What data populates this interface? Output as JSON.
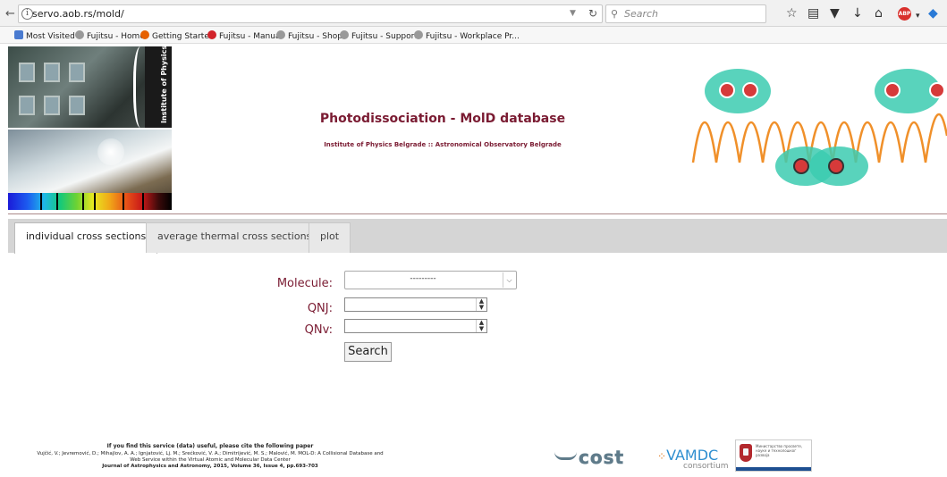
{
  "browser": {
    "url": "servo.aob.rs/mold/",
    "search_placeholder": "Search"
  },
  "bookmarks": [
    {
      "label": "Most Visited",
      "icon": "most-visited-icon",
      "color": "#4a7bd0"
    },
    {
      "label": "Fujitsu - Home",
      "icon": "globe-icon",
      "color": "#888888"
    },
    {
      "label": "Getting Started",
      "icon": "firefox-icon",
      "color": "#e66000"
    },
    {
      "label": "Fujitsu - Manual",
      "icon": "infinity-icon",
      "color": "#d2232a"
    },
    {
      "label": "Fujitsu - Shop",
      "icon": "globe-icon",
      "color": "#888888"
    },
    {
      "label": "Fujitsu - Support",
      "icon": "globe-icon",
      "color": "#888888"
    },
    {
      "label": "Fujitsu - Workplace Pr...",
      "icon": "globe-icon",
      "color": "#888888"
    }
  ],
  "header": {
    "title": "Photodissociation - MolD database",
    "subtitle": "Institute of Physics Belgrade :: Astronomical Observatory Belgrade",
    "ribbon_text": "Institute of Physics Belgrade - Serbia",
    "accent_color": "#7a1b32"
  },
  "tabs": [
    {
      "label": "individual cross sections",
      "active": true
    },
    {
      "label": "average thermal cross sections",
      "active": false
    },
    {
      "label": "plot",
      "active": false
    }
  ],
  "form": {
    "molecule_label": "Molecule:",
    "molecule_value": "---------",
    "qnj_label": "QNJ:",
    "qnv_label": "QNv:",
    "search_label": "Search"
  },
  "footer": {
    "cite_heading": "If you find this service (data) useful, please cite the following paper",
    "cite_line1": "Vujčić, V.; Jevremović, D.; Mihajlov, A. A.; Ignjatović, Lj. M.; Srećković, V. A.; Dimitrijević, M. S.; Malović, M. MOL-D: A Collisional Database and",
    "cite_line2": "Web Service within the Virtual Atomic and Molecular Data Center",
    "cite_line3": "Journal of Astrophysics and Astronomy, 2015, Volume 36, Issue 4, pp.693-703",
    "logo_cost": "cost",
    "logo_vamdc": "VAMDC",
    "logo_vamdc_sub": "consortium",
    "logo_ministry_text": "Министарство просвете, науке и технолошког развоја"
  }
}
